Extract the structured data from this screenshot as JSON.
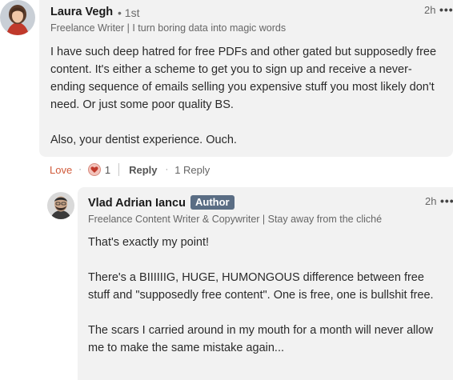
{
  "comment": {
    "author": "Laura Vegh",
    "degree": "• 1st",
    "headline": "Freelance Writer | I turn boring data into magic words",
    "time": "2h",
    "more": "•••",
    "paragraphs": [
      "I have such deep hatred for free PDFs and other gated but supposedly free content. It's either a scheme to get you to sign up and receive a never-ending sequence of emails selling you expensive stuff you most likely don't need. Or just some poor quality BS.",
      "Also, your dentist experience. Ouch."
    ]
  },
  "actions": {
    "love": "Love",
    "sep1": "·",
    "reaction_icon": "love-heart-icon",
    "reaction_count": "1",
    "reply": "Reply",
    "sep2": "·",
    "reply_count": "1 Reply"
  },
  "reply": {
    "author": "Vlad Adrian Iancu",
    "badge": "Author",
    "headline": "Freelance Content Writer & Copywriter | Stay away from the cliché",
    "time": "2h",
    "more": "•••",
    "paragraphs": [
      "That's exactly my point!",
      "There's a BIIIIIIG, HUGE, HUMONGOUS difference between free stuff and \"supposedly free content\". One is free, one is bullshit free.",
      "The scars I carried around in my mouth for a month will never allow me to make the same mistake again..."
    ]
  }
}
